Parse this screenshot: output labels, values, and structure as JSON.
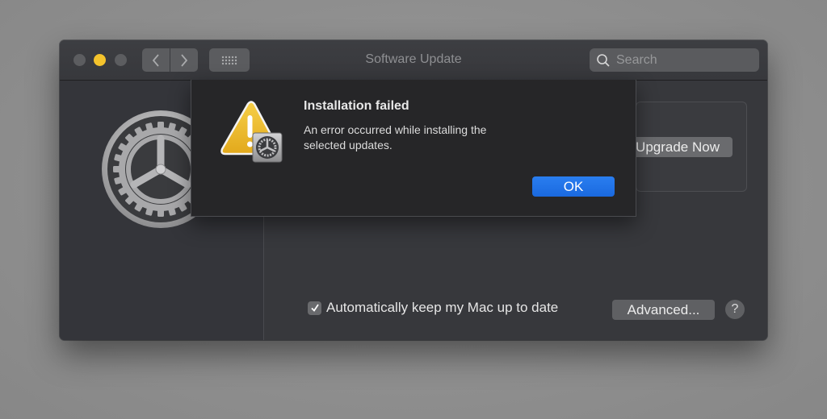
{
  "window": {
    "title": "Software Update",
    "traffic_lights": [
      "close",
      "minimize",
      "zoom"
    ],
    "nav": {
      "back_icon": "chevron-left-icon",
      "forward_icon": "chevron-right-icon",
      "grid_icon": "show-all-grid-icon"
    },
    "search": {
      "placeholder": "Search",
      "value": ""
    }
  },
  "sidebar": {
    "icon": "system-preferences-gear-icon"
  },
  "main": {
    "upgrade_button": "Upgrade Now",
    "auto_update": {
      "label": "Automatically keep my Mac up to date",
      "checked": true
    },
    "advanced_button": "Advanced...",
    "help_button": "?"
  },
  "dialog": {
    "icon": "warning-triangle-icon",
    "title": "Installation failed",
    "message": "An error occurred while installing the selected updates.",
    "ok_button": "OK"
  },
  "colors": {
    "accent": "#1f72e6",
    "minimize_light": "#f4c32c",
    "warning": "#f0c030"
  }
}
